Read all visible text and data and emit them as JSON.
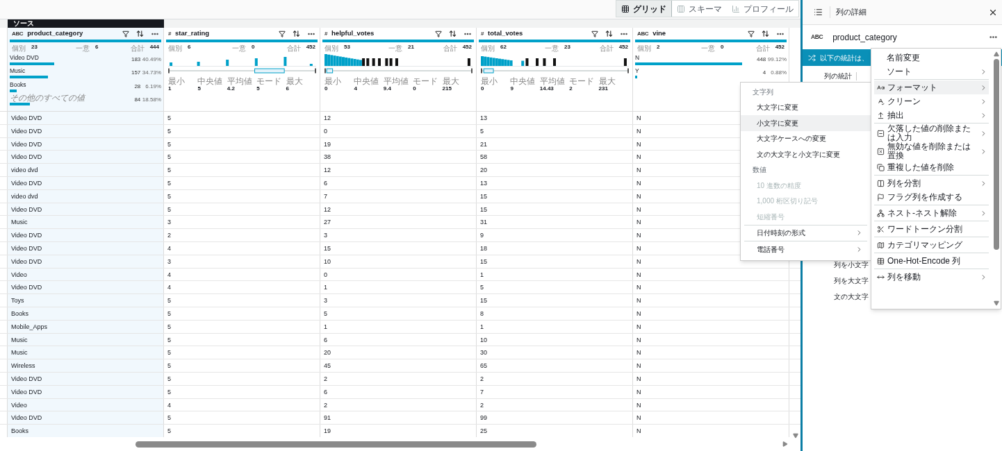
{
  "toolbar": {
    "views": [
      {
        "label": "グリッド",
        "kind": "grid",
        "selected": true
      },
      {
        "label": "スキーマ",
        "kind": "schema",
        "selected": false
      },
      {
        "label": "プロフィール",
        "kind": "profile",
        "selected": false
      }
    ]
  },
  "grid": {
    "source_label": "ソース",
    "columns": [
      {
        "name": "product_category",
        "kind": "text",
        "type_label": "ABC",
        "selected": true,
        "counts": [
          {
            "label": "個別",
            "value": "23"
          },
          {
            "label": "一意",
            "value": "6"
          },
          {
            "label": "合計",
            "value": "444"
          }
        ],
        "top_values": [
          {
            "label": "Video DVD",
            "count": "183",
            "percent": "40.49%",
            "level": 0.29,
            "kind": "value"
          },
          {
            "label": "Music",
            "count": "157",
            "percent": "34.73%",
            "level": 0.25,
            "kind": "value"
          },
          {
            "label": "Books",
            "count": "28",
            "percent": "6.19%",
            "level": 0.045,
            "kind": "value"
          },
          {
            "label": "その他のすべての値",
            "count": "84",
            "percent": "18.58%",
            "level": 0.13,
            "kind": "other"
          }
        ]
      },
      {
        "name": "star_rating",
        "kind": "number",
        "type_label": "#",
        "selected": false,
        "counts": [
          {
            "label": "個別",
            "value": "6"
          },
          {
            "label": "一意",
            "value": "0"
          },
          {
            "label": "合計",
            "value": "452"
          }
        ],
        "stats": [
          {
            "label": "最小",
            "value": "1"
          },
          {
            "label": "中央値",
            "value": "5"
          },
          {
            "label": "平均値",
            "value": "4.2"
          },
          {
            "label": "モード",
            "value": "5"
          },
          {
            "label": "最大",
            "value": "6"
          }
        ]
      },
      {
        "name": "helpful_votes",
        "kind": "number",
        "type_label": "#",
        "selected": false,
        "counts": [
          {
            "label": "個別",
            "value": "53"
          },
          {
            "label": "一意",
            "value": "21"
          },
          {
            "label": "合計",
            "value": "452"
          }
        ],
        "stats": [
          {
            "label": "最小",
            "value": "0"
          },
          {
            "label": "中央値",
            "value": "4"
          },
          {
            "label": "平均値",
            "value": "9.4"
          },
          {
            "label": "モード",
            "value": "0"
          },
          {
            "label": "最大",
            "value": "215"
          }
        ]
      },
      {
        "name": "total_votes",
        "kind": "number",
        "type_label": "#",
        "selected": false,
        "counts": [
          {
            "label": "個別",
            "value": "62"
          },
          {
            "label": "一意",
            "value": "23"
          },
          {
            "label": "合計",
            "value": "452"
          }
        ],
        "stats": [
          {
            "label": "最小",
            "value": "0"
          },
          {
            "label": "中央値",
            "value": "9"
          },
          {
            "label": "平均値",
            "value": "14.43"
          },
          {
            "label": "モード",
            "value": "2"
          },
          {
            "label": "最大",
            "value": "231"
          }
        ]
      },
      {
        "name": "vine",
        "kind": "text",
        "type_label": "ABC",
        "selected": false,
        "counts": [
          {
            "label": "個別",
            "value": "2"
          },
          {
            "label": "一意",
            "value": "0"
          },
          {
            "label": "合計",
            "value": "452"
          }
        ],
        "top_values": [
          {
            "label": "N",
            "count": "448",
            "percent": "99.12%",
            "level": 0.7,
            "kind": "value"
          },
          {
            "label": "Y",
            "count": "4",
            "percent": "0.88%",
            "level": 0.015,
            "kind": "value"
          }
        ]
      }
    ],
    "rows": [
      [
        "Video DVD",
        "5",
        "12",
        "13",
        "N"
      ],
      [
        "Video DVD",
        "5",
        "0",
        "5",
        "N"
      ],
      [
        "Video DVD",
        "5",
        "19",
        "21",
        "N"
      ],
      [
        "Video DVD",
        "5",
        "38",
        "58",
        "N"
      ],
      [
        "video dvd",
        "5",
        "12",
        "20",
        "N"
      ],
      [
        "Video DVD",
        "5",
        "6",
        "13",
        "N"
      ],
      [
        "video dvd",
        "5",
        "7",
        "15",
        "N"
      ],
      [
        "Video DVD",
        "5",
        "12",
        "15",
        "N"
      ],
      [
        "Music",
        "3",
        "27",
        "31",
        "N"
      ],
      [
        "Video DVD",
        "2",
        "3",
        "9",
        "N"
      ],
      [
        "Video DVD",
        "4",
        "15",
        "18",
        "N"
      ],
      [
        "Video DVD",
        "3",
        "10",
        "15",
        "N"
      ],
      [
        "Video",
        "4",
        "0",
        "1",
        "N"
      ],
      [
        "Video DVD",
        "4",
        "1",
        "5",
        "N"
      ],
      [
        "Toys",
        "5",
        "3",
        "15",
        "N"
      ],
      [
        "Books",
        "5",
        "5",
        "8",
        "N"
      ],
      [
        "Mobile_Apps",
        "5",
        "1",
        "1",
        "N"
      ],
      [
        "Music",
        "5",
        "6",
        "10",
        "N"
      ],
      [
        "Music",
        "5",
        "20",
        "30",
        "N"
      ],
      [
        "Wireless",
        "5",
        "45",
        "65",
        "N"
      ],
      [
        "Video DVD",
        "5",
        "2",
        "2",
        "N"
      ],
      [
        "Video DVD",
        "5",
        "6",
        "7",
        "N"
      ],
      [
        "Video",
        "4",
        "2",
        "2",
        "N"
      ],
      [
        "Video DVD",
        "5",
        "91",
        "99",
        "N"
      ],
      [
        "Books",
        "5",
        "19",
        "25",
        "N"
      ]
    ]
  },
  "details_panel": {
    "title": "列の詳細",
    "column_type": "ABC",
    "column_name": "product_category",
    "banner": "以下の統計は、",
    "tab": "列の統計",
    "hidden_items": [
      "列を小文字",
      "列を大文字",
      "文の大文字"
    ]
  },
  "column_menu": {
    "groups": [
      [
        {
          "label": "名前変更",
          "submenu": false,
          "selected": false
        },
        {
          "label": "ソート",
          "submenu": true,
          "selected": false
        }
      ],
      [
        {
          "label": "フォーマット",
          "submenu": true,
          "selected": true
        },
        {
          "label": "クリーン",
          "submenu": true,
          "selected": false
        },
        {
          "label": "抽出",
          "submenu": true,
          "selected": false
        }
      ],
      [
        {
          "label": "欠落した値の削除または入力",
          "submenu": true,
          "selected": false
        },
        {
          "label": "無効な値を削除または置換",
          "submenu": true,
          "selected": false
        },
        {
          "label": "重複した値を削除",
          "submenu": false,
          "selected": false
        }
      ],
      [
        {
          "label": "列を分割",
          "submenu": true,
          "selected": false
        },
        {
          "label": "フラグ列を作成する",
          "submenu": false,
          "selected": false
        }
      ],
      [
        {
          "label": "ネスト-ネスト解除",
          "submenu": true,
          "selected": false
        }
      ],
      [
        {
          "label": "ワードトークン分割",
          "submenu": false,
          "selected": false
        }
      ],
      [
        {
          "label": "カテゴリマッピング",
          "submenu": false,
          "selected": false
        }
      ],
      [
        {
          "label": "One-Hot-Encode 列",
          "submenu": false,
          "selected": false
        }
      ],
      [
        {
          "label": "列を移動",
          "submenu": true,
          "selected": false
        }
      ]
    ]
  },
  "format_submenu": {
    "groups": [
      [
        {
          "label": "文字列",
          "kind": "header"
        },
        {
          "label": "大文字に変更",
          "kind": "item",
          "selected": false,
          "disabled": false,
          "submenu": false
        },
        {
          "label": "小文字に変更",
          "kind": "item",
          "selected": true,
          "disabled": false,
          "submenu": false
        },
        {
          "label": "大文字ケースへの変更",
          "kind": "item",
          "selected": false,
          "disabled": false,
          "submenu": false
        },
        {
          "label": "文の大文字と小文字に変更",
          "kind": "item",
          "selected": false,
          "disabled": false,
          "submenu": false
        },
        {
          "label": "数値",
          "kind": "header"
        },
        {
          "label": "10 進数の精度",
          "kind": "item",
          "selected": false,
          "disabled": true,
          "submenu": false
        },
        {
          "label": "1,000 桁区切り記号",
          "kind": "item",
          "selected": false,
          "disabled": true,
          "submenu": false
        },
        {
          "label": "短縮番号",
          "kind": "item",
          "selected": false,
          "disabled": true,
          "submenu": false
        }
      ],
      [
        {
          "label": "日付時刻の形式",
          "kind": "item",
          "selected": false,
          "disabled": false,
          "submenu": true
        }
      ],
      [
        {
          "label": "電話番号",
          "kind": "item",
          "selected": false,
          "disabled": false,
          "submenu": true
        }
      ]
    ]
  }
}
